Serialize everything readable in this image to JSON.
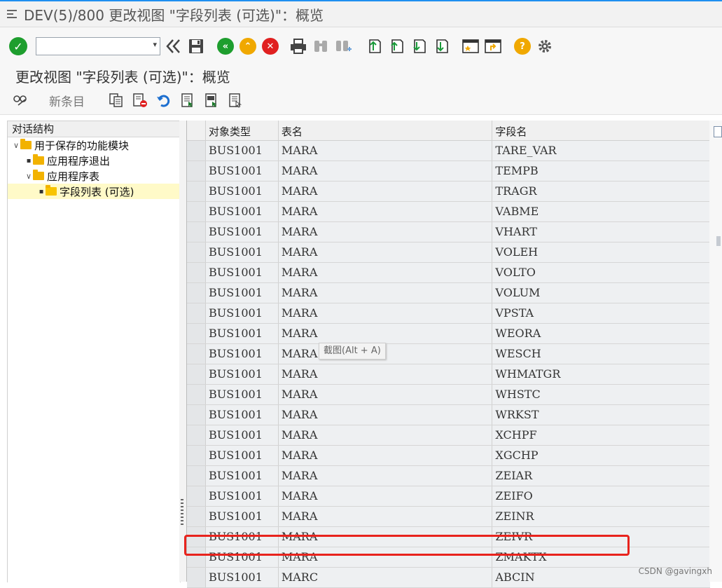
{
  "window": {
    "title": "DEV(5)/800 更改视图 \"字段列表 (可选)\"：概览"
  },
  "toolbar": {
    "command_field_value": "",
    "icons": [
      "enter-check-icon",
      "command-dropdown-icon",
      "history-back-icon",
      "save-icon",
      "back-icon",
      "exit-icon",
      "cancel-icon",
      "print-icon",
      "find-icon",
      "find-next-icon",
      "first-page-icon",
      "previous-page-icon",
      "next-page-icon",
      "last-page-icon",
      "create-session-icon",
      "generate-shortcut-icon",
      "help-icon",
      "settings-icon"
    ],
    "accent_colors": {
      "ok": "#1e9e2e",
      "back": "#1e9e2e",
      "exit": "#f0a800",
      "cancel": "#e02020",
      "help": "#f0a800"
    }
  },
  "screen": {
    "subtitle": "更改视图 \"字段列表 (可选)\"：概览"
  },
  "actions": {
    "new_entry_label": "新条目",
    "icons": [
      "display-change-icon",
      "copy-icon",
      "delete-icon",
      "undo-icon",
      "select-all-icon",
      "select-block-icon",
      "deselect-all-icon"
    ]
  },
  "tree": {
    "header": "对话结构",
    "nodes": [
      {
        "label": "用于保存的功能模块",
        "level": 0,
        "expanded": true
      },
      {
        "label": "应用程序退出",
        "level": 1,
        "expanded": false
      },
      {
        "label": "应用程序表",
        "level": 1,
        "expanded": true
      },
      {
        "label": "字段列表 (可选)",
        "level": 2,
        "selected": true
      }
    ]
  },
  "table": {
    "columns": [
      "对象类型",
      "表名",
      "字段名"
    ],
    "rows": [
      [
        "BUS1001",
        "MARA",
        "TARE_VAR"
      ],
      [
        "BUS1001",
        "MARA",
        "TEMPB"
      ],
      [
        "BUS1001",
        "MARA",
        "TRAGR"
      ],
      [
        "BUS1001",
        "MARA",
        "VABME"
      ],
      [
        "BUS1001",
        "MARA",
        "VHART"
      ],
      [
        "BUS1001",
        "MARA",
        "VOLEH"
      ],
      [
        "BUS1001",
        "MARA",
        "VOLTO"
      ],
      [
        "BUS1001",
        "MARA",
        "VOLUM"
      ],
      [
        "BUS1001",
        "MARA",
        "VPSTA"
      ],
      [
        "BUS1001",
        "MARA",
        "WEORA"
      ],
      [
        "BUS1001",
        "MARA",
        "WESCH"
      ],
      [
        "BUS1001",
        "MARA",
        "WHMATGR"
      ],
      [
        "BUS1001",
        "MARA",
        "WHSTC"
      ],
      [
        "BUS1001",
        "MARA",
        "WRKST"
      ],
      [
        "BUS1001",
        "MARA",
        "XCHPF"
      ],
      [
        "BUS1001",
        "MARA",
        "XGCHP"
      ],
      [
        "BUS1001",
        "MARA",
        "ZEIAR"
      ],
      [
        "BUS1001",
        "MARA",
        "ZEIFO"
      ],
      [
        "BUS1001",
        "MARA",
        "ZEINR"
      ],
      [
        "BUS1001",
        "MARA",
        "ZEIVR"
      ],
      [
        "BUS1001",
        "MARA",
        "ZMAKTX"
      ],
      [
        "BUS1001",
        "MARC",
        "ABCIN"
      ]
    ],
    "highlighted_row": 20,
    "highlight_color": "#e8231d"
  },
  "tooltip": {
    "text": "截图(Alt + A)"
  },
  "watermark": "CSDN @gavingxh"
}
